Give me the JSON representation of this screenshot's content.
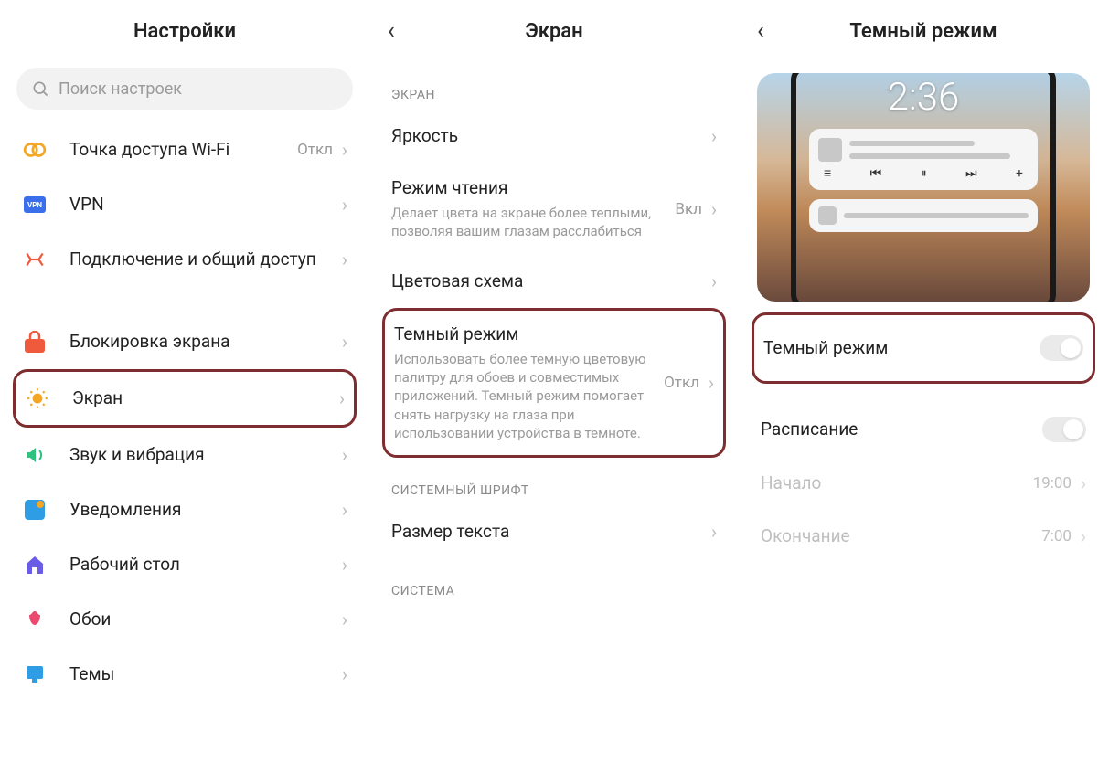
{
  "col1": {
    "title": "Настройки",
    "search_placeholder": "Поиск настроек",
    "items": {
      "wifi": {
        "label": "Точка доступа Wi-Fi",
        "value": "Откл"
      },
      "vpn": {
        "label": "VPN"
      },
      "share": {
        "label": "Подключение и общий доступ"
      },
      "lock": {
        "label": "Блокировка экрана"
      },
      "screen": {
        "label": "Экран"
      },
      "sound": {
        "label": "Звук и вибрация"
      },
      "notif": {
        "label": "Уведомления"
      },
      "home": {
        "label": "Рабочий стол"
      },
      "wall": {
        "label": "Обои"
      },
      "themes": {
        "label": "Темы"
      }
    }
  },
  "col2": {
    "title": "Экран",
    "section_screen": "ЭКРАН",
    "section_font": "СИСТЕМНЫЙ ШРИФТ",
    "section_system": "СИСТЕМА",
    "items": {
      "brightness": {
        "label": "Яркость"
      },
      "reading": {
        "label": "Режим чтения",
        "desc": "Делает цвета на экране более теплыми, позволяя вашим глазам расслабиться",
        "value": "Вкл"
      },
      "colorscheme": {
        "label": "Цветовая схема"
      },
      "dark": {
        "label": "Темный режим",
        "desc": "Использовать более темную цветовую палитру для обоев и совместимых приложений. Темный режим помогает снять нагрузку на глаза при использовании устройства в темноте.",
        "value": "Откл"
      },
      "textsize": {
        "label": "Размер текста"
      }
    }
  },
  "col3": {
    "title": "Темный режим",
    "preview_time": "2:36",
    "items": {
      "dark_toggle": {
        "label": "Темный режим"
      },
      "schedule": {
        "label": "Расписание"
      },
      "start": {
        "label": "Начало",
        "value": "19:00"
      },
      "end": {
        "label": "Окончание",
        "value": "7:00"
      }
    }
  }
}
